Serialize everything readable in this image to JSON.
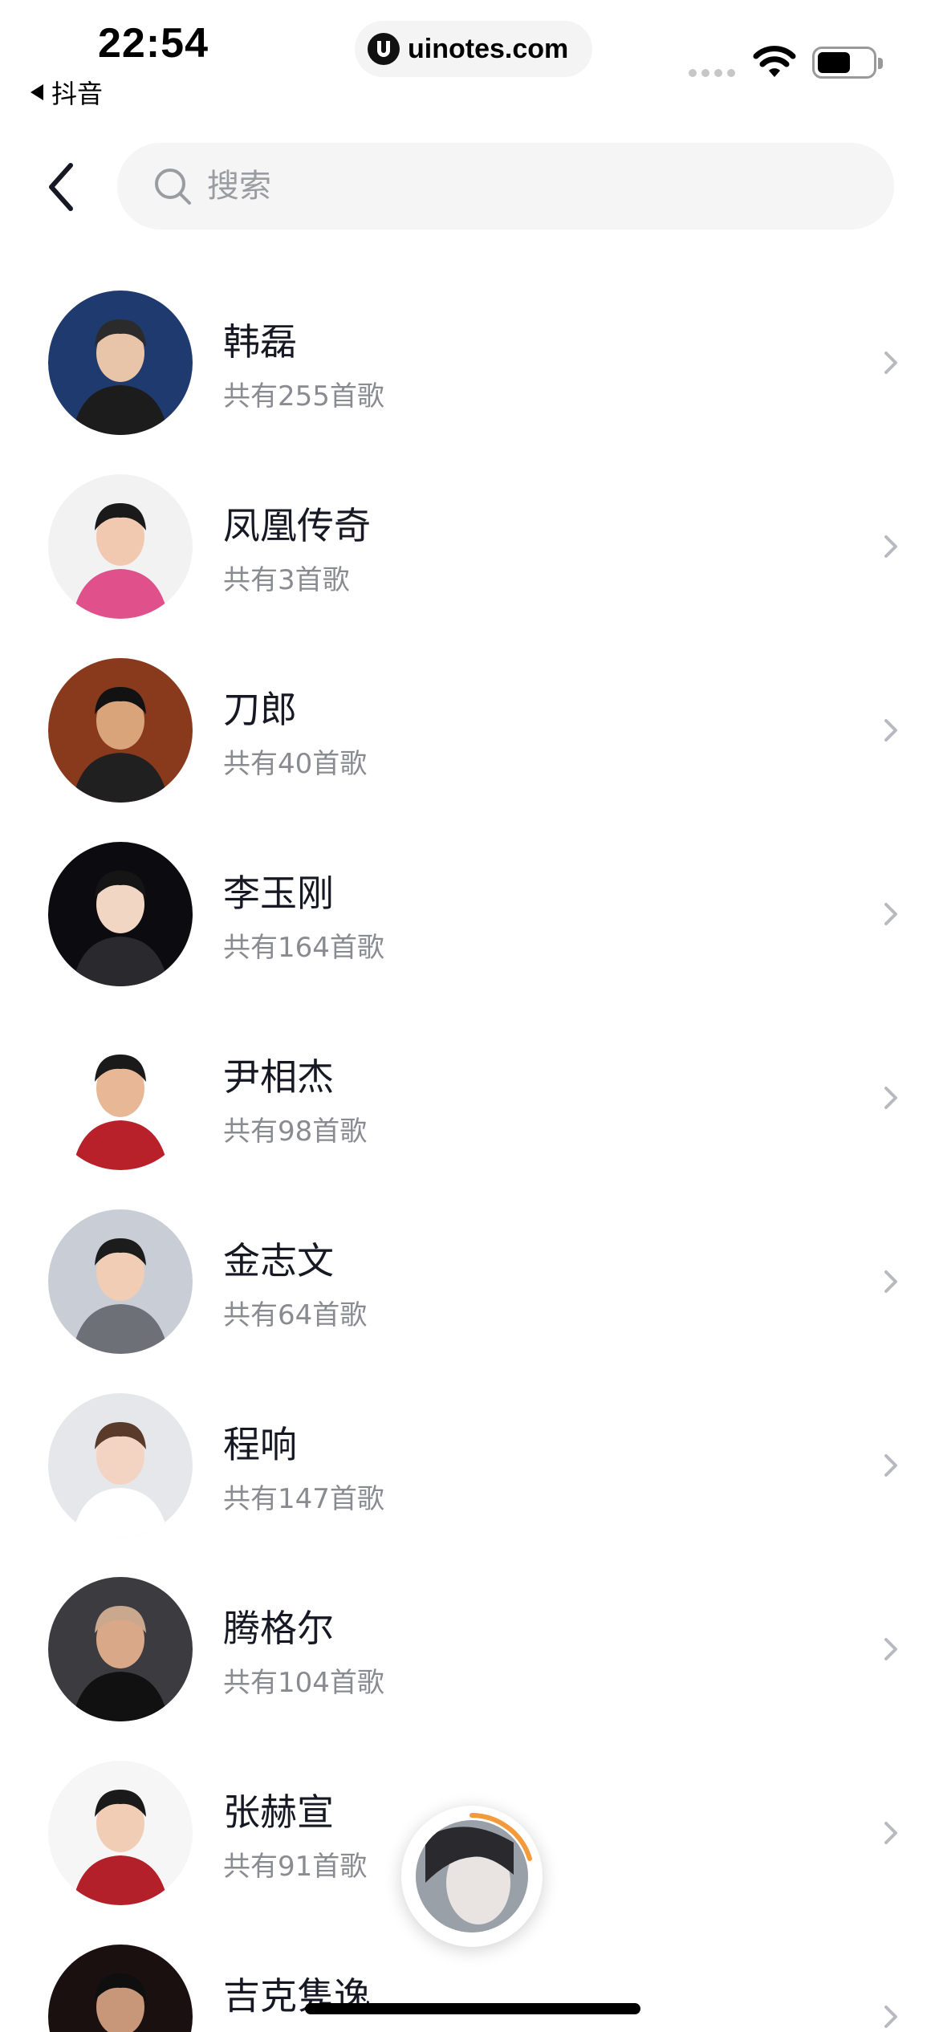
{
  "status_bar": {
    "time": "22:54",
    "back_app": "抖音",
    "url": "uinotes.com"
  },
  "search": {
    "placeholder": "搜索"
  },
  "artists": [
    {
      "name": "韩磊",
      "count": "共有255首歌",
      "bg": "#1f3a6e",
      "skin": "#e8c4a8",
      "clothes": "#1c1c1c",
      "hair": "#2b2b2b"
    },
    {
      "name": "凤凰传奇",
      "count": "共有3首歌",
      "bg": "#f2f2f2",
      "skin": "#f0c9b0",
      "clothes": "#e0508a",
      "hair": "#1a1a1a"
    },
    {
      "name": "刀郎",
      "count": "共有40首歌",
      "bg": "#8a3a1c",
      "skin": "#d9a47a",
      "clothes": "#202020",
      "hair": "#121212"
    },
    {
      "name": "李玉刚",
      "count": "共有164首歌",
      "bg": "#0c0c10",
      "skin": "#f2d6c4",
      "clothes": "#2a2a2e",
      "hair": "#151515"
    },
    {
      "name": "尹相杰",
      "count": "共有98首歌",
      "bg": "#ffffff",
      "skin": "#e8b896",
      "clothes": "#b8202a",
      "hair": "#1a1a1a"
    },
    {
      "name": "金志文",
      "count": "共有64首歌",
      "bg": "#c9cdd6",
      "skin": "#f0cdb4",
      "clothes": "#6d7077",
      "hair": "#1c1c1c"
    },
    {
      "name": "程响",
      "count": "共有147首歌",
      "bg": "#e6e7ea",
      "skin": "#f3d4c2",
      "clothes": "#ffffff",
      "hair": "#5a3a2a"
    },
    {
      "name": "腾格尔",
      "count": "共有104首歌",
      "bg": "#3b3b40",
      "skin": "#d8a888",
      "clothes": "#111111",
      "hair": "#caa88e"
    },
    {
      "name": "张赫宣",
      "count": "共有91首歌",
      "bg": "#f6f6f6",
      "skin": "#f1cdb6",
      "clothes": "#b3202a",
      "hair": "#1a1a1a"
    },
    {
      "name": "吉克隽逸",
      "count": "",
      "bg": "#1a1010",
      "skin": "#c89678",
      "clothes": "#3a2020",
      "hair": "#0f0f0f"
    }
  ],
  "colors": {
    "primary_text": "#161823",
    "secondary_text": "#8a8b91",
    "search_bg": "#f5f5f5",
    "chevron": "#b9bac0",
    "disc_ring": "#f39a3a"
  },
  "icons": {
    "back": "chevron-left-icon",
    "search": "search-icon",
    "row": "chevron-right-icon",
    "music": "music-disc-icon"
  }
}
